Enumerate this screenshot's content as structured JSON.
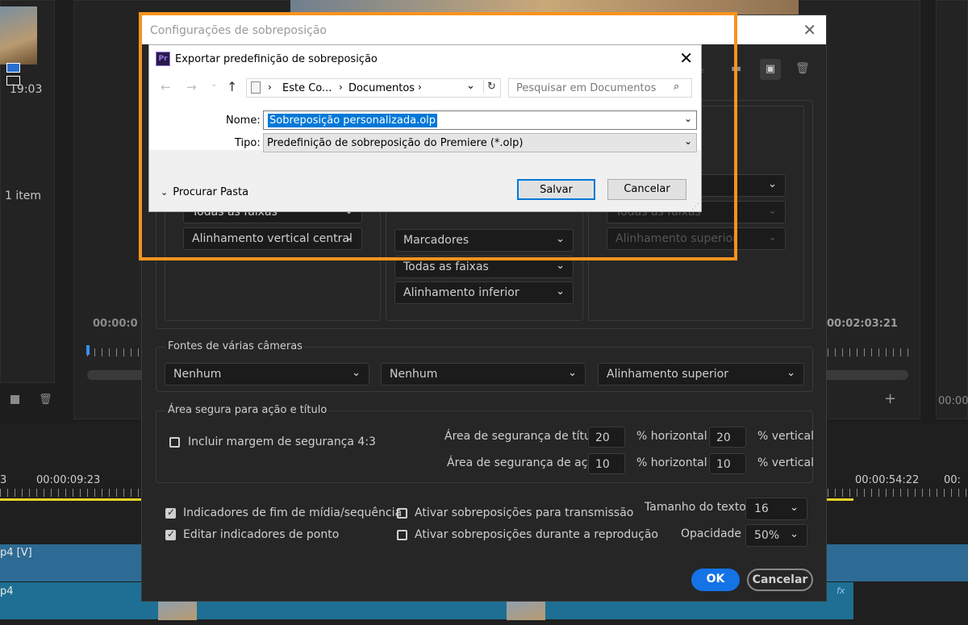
{
  "background": {
    "clip_time": "19:03",
    "items_count": "1 item",
    "tc_left": "00:00:0",
    "tc_right": "00:02:03:21",
    "tc_far_right": "00:00:",
    "timeline_tc_a": "3",
    "timeline_tc_b": "00:00:09:23",
    "timeline_tc_c": "00:00:54:22",
    "timeline_tc_d": "00:",
    "track_v": "p4 [V]",
    "track_a": "p4",
    "fx_label": "fx"
  },
  "overlay_dialog": {
    "title": "Configurações de sobreposição",
    "col1": {
      "sel_top_hidden": "Todas as faixas",
      "sel_align": "Alinhamento vertical central"
    },
    "col2": {
      "sel_markers": "Marcadores",
      "sel_tracks": "Todas as faixas",
      "sel_align": "Alinhamento inferior"
    },
    "col3": {
      "sel_tracks": "Todas as faixas",
      "sel_align": "Alinhamento superior"
    },
    "multicam": {
      "label": "Fontes de várias câmeras",
      "sel1": "Nenhum",
      "sel2": "Nenhum",
      "sel3": "Alinhamento superior"
    },
    "safe": {
      "label": "Área segura para ação e título",
      "include_43": "Incluir margem de segurança 4:3",
      "title_safe_label": "Área de segurança de título",
      "title_h": "20",
      "title_v": "20",
      "action_safe_label": "Área de segurança de ação",
      "action_h": "10",
      "action_v": "10",
      "h_unit": "% horizontal",
      "v_unit": "% vertical"
    },
    "options": {
      "end_indicators": "Indicadores de fim de mídia/sequência",
      "edit_indicators": "Editar indicadores de ponto",
      "broadcast": "Ativar sobreposições para transmissão",
      "playback": "Ativar sobreposições durante a reprodução",
      "text_size_label": "Tamanho do texto",
      "text_size": "16",
      "opacity_label": "Opacidade",
      "opacity": "50%"
    },
    "ok": "OK",
    "cancel": "Cancelar"
  },
  "save_dialog": {
    "title": "Exportar predefinição de sobreposição",
    "logo": "Pr",
    "breadcrumb_1": "Este Co...",
    "breadcrumb_2": "Documentos",
    "search_placeholder": "Pesquisar em Documentos",
    "name_label": "Nome:",
    "name_value": "Sobreposição personalizada.olp",
    "type_label": "Tipo:",
    "type_value": "Predefinição de sobreposição do Premiere (*.olp)",
    "browse_folders": "Procurar Pasta",
    "save": "Salvar",
    "cancel": "Cancelar"
  },
  "colors": {
    "accent_blue": "#1473e6",
    "highlight_orange": "#f7931e",
    "win_selection": "#0078d7"
  }
}
